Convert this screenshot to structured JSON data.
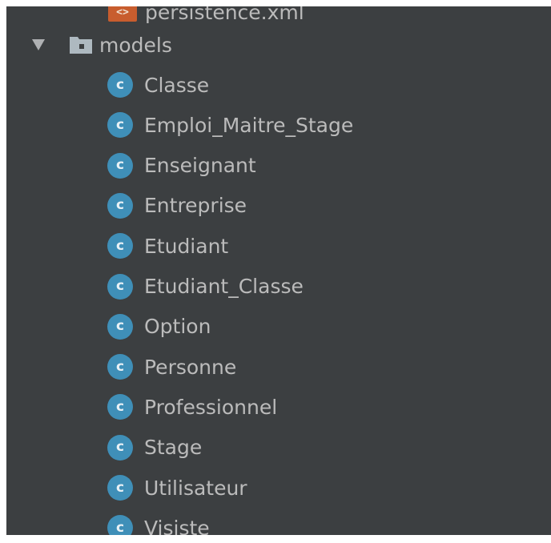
{
  "tree": {
    "clipped_item": {
      "icon": "xml-file-icon",
      "label": "persistence.xml",
      "icon_glyph": "<>"
    },
    "folder": {
      "label": "models",
      "expanded": true,
      "icon": "folder-icon",
      "arrow_icon": "expand-arrow-icon"
    },
    "class_icon_glyph": "c",
    "classes": [
      {
        "label": "Classe"
      },
      {
        "label": "Emploi_Maitre_Stage"
      },
      {
        "label": "Enseignant"
      },
      {
        "label": "Entreprise"
      },
      {
        "label": "Etudiant"
      },
      {
        "label": "Etudiant_Classe"
      },
      {
        "label": "Option"
      },
      {
        "label": "Personne"
      },
      {
        "label": "Professionnel"
      },
      {
        "label": "Stage"
      },
      {
        "label": "Utilisateur"
      },
      {
        "label": "Visiste"
      }
    ]
  },
  "colors": {
    "panel_bg": "#3c3f41",
    "text": "#bbbbbb",
    "class_icon": "#3f8fb8",
    "xml_icon": "#c85d2e",
    "folder_icon": "#aeb9c0"
  }
}
